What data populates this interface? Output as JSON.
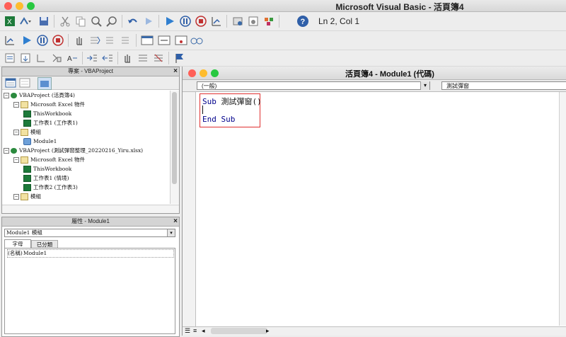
{
  "app": {
    "title": "Microsoft Visual Basic - 活頁簿4",
    "status_position": "Ln 2, Col 1"
  },
  "project_panel": {
    "title": "專案 - VBAProject",
    "tree": [
      {
        "label": "VBAProject (活頁簿4)",
        "kind": "project"
      },
      {
        "label": "Microsoft Excel 物件",
        "kind": "folder"
      },
      {
        "label": "ThisWorkbook",
        "kind": "excel"
      },
      {
        "label": "工作表1 (工作表1)",
        "kind": "excel"
      },
      {
        "label": "模組",
        "kind": "folder"
      },
      {
        "label": "Module1",
        "kind": "module"
      },
      {
        "label": "VBAProject (測試彈窗整理_20220216_Yiru.xlsx)",
        "kind": "project"
      },
      {
        "label": "Microsoft Excel 物件",
        "kind": "folder"
      },
      {
        "label": "ThisWorkbook",
        "kind": "excel"
      },
      {
        "label": "工作表1 (情境)",
        "kind": "excel"
      },
      {
        "label": "工作表2 (工作表3)",
        "kind": "excel"
      },
      {
        "label": "模組",
        "kind": "folder"
      }
    ]
  },
  "properties_panel": {
    "title": "屬性 - Module1",
    "object_select": "Module1 模組",
    "tabs": [
      "字母",
      "已分類"
    ],
    "property_name": "(名稱)",
    "property_value": "Module1"
  },
  "code_window": {
    "title": "活頁簿4 - Module1 (代碼)",
    "object_combo": "(一般)",
    "procedure_combo": "測試彈窗",
    "lines": [
      {
        "keyword": "Sub",
        "rest": " 測試彈窗()"
      },
      {
        "keyword": "",
        "rest": ""
      },
      {
        "keyword": "End Sub",
        "rest": ""
      }
    ]
  },
  "colors": {
    "keyword": "#00008b",
    "highlight_box": "#e03030",
    "close": "#ff5f57",
    "minimize": "#febc2e",
    "zoom": "#28c840"
  }
}
